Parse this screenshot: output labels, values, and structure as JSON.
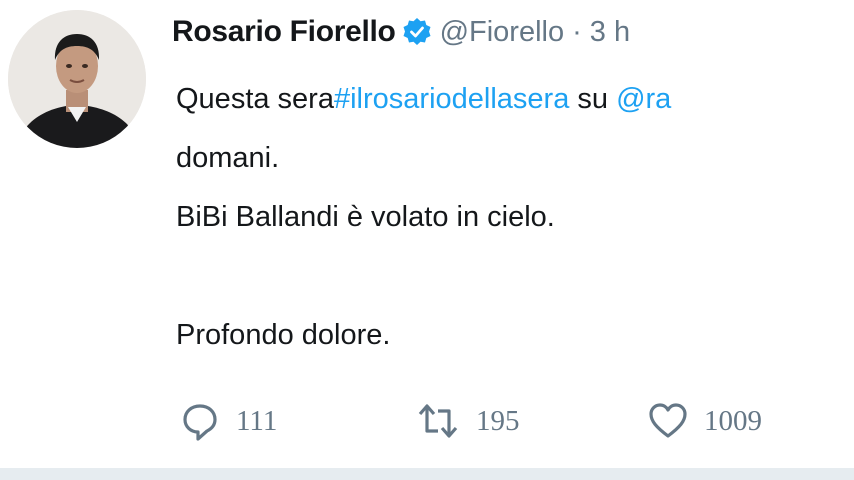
{
  "tweet": {
    "author": {
      "name": "Rosario Fiorello",
      "handle": "@Fiorello",
      "separator": "·",
      "time": "3 h",
      "verified": true
    },
    "text": {
      "line1_prefix": "Questa sera",
      "hashtag": "#ilrosariodellasera",
      "line1_middle": " su ",
      "mention": "@ra",
      "line2": "domani.",
      "line3": "BiBi Ballandi è volato in cielo.",
      "line5": "Profondo dolore."
    },
    "actions": {
      "replies": "111",
      "retweets": "195",
      "likes": "1009"
    }
  },
  "colors": {
    "accent": "#1da1f2",
    "text": "#14171a",
    "muted": "#657786"
  },
  "icons": {
    "verified": "verified-badge-icon",
    "reply": "speech-bubble-icon",
    "retweet": "retweet-arrows-icon",
    "like": "heart-outline-icon"
  }
}
